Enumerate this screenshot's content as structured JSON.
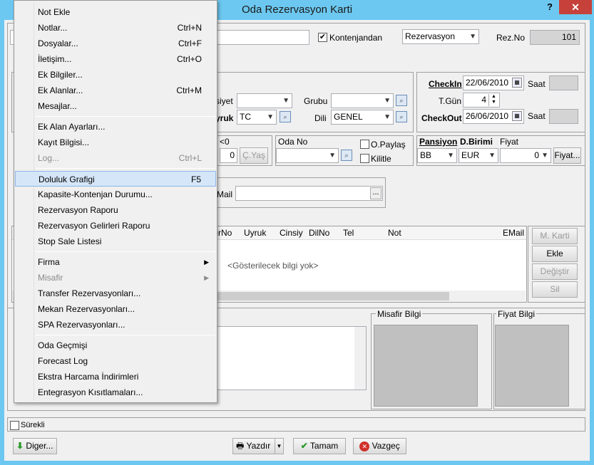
{
  "window": {
    "title": "Oda Rezervasyon Karti",
    "help": "?",
    "close": "✕"
  },
  "header": {
    "kontenjan_label": "Kontenjandan",
    "kontenjan_checked": true,
    "status_value": "Rezervasyon",
    "rezno_label": "Rez.No",
    "rezno_value": "101"
  },
  "guest": {
    "cinsiyet_label": "siyet",
    "grubu_label": "Grubu",
    "uyruk_label": "yruk",
    "uyruk_value": "TC",
    "dili_label": "Dili",
    "dili_value": "GENEL"
  },
  "dates": {
    "checkin_label": "CheckIn",
    "checkin_value": "22/06/2010",
    "saat_label": "Saat",
    "tgun_label": "T.Gün",
    "tgun_value": "4",
    "checkout_label": "CheckOut",
    "checkout_value": "26/06/2010"
  },
  "room": {
    "lt0_label": "<0",
    "lt0_value": "0",
    "cyas_button": "Ç.Yaş",
    "oda_no_label": "Oda No",
    "opaylas_label": "O.Paylaş",
    "kilitle_label": "Kilitle",
    "pansiyon_label": "Pansiyon",
    "dbirimi_label": "D.Birimi",
    "fiyat_label": "Fiyat",
    "pansiyon_value": "BB",
    "dbirimi_value": "EUR",
    "fiyat_value": "0",
    "fiyat_button": "Fiyat..."
  },
  "mail": {
    "label": "Mail",
    "button": "..."
  },
  "grid": {
    "columns": [
      "firNo",
      "Uyruk",
      "Cinsiy",
      "DilNo",
      "Tel",
      "Not",
      "EMail"
    ],
    "empty_text": "<Gösterilecek bilgi yok>",
    "side_buttons": [
      "M. Karti",
      "Ekle",
      "Değiştir",
      "Sil"
    ]
  },
  "bottom": {
    "misafir_bilgi": "Misafir Bilgi",
    "fiyat_bilgi": "Fiyat Bilgi",
    "surekli_label": "Sürekli",
    "diger_button": "Diger...",
    "yazdir_button": "Yazdır",
    "tamam_button": "Tamam",
    "vazgec_button": "Vazgeç"
  },
  "menu": {
    "items": [
      {
        "label": "Not Ekle",
        "shortcut": ""
      },
      {
        "label": "Notlar...",
        "shortcut": "Ctrl+N"
      },
      {
        "label": "Dosyalar...",
        "shortcut": "Ctrl+F"
      },
      {
        "label": "İletişim...",
        "shortcut": "Ctrl+O"
      },
      {
        "label": "Ek Bilgiler...",
        "shortcut": ""
      },
      {
        "label": "Ek Alanlar...",
        "shortcut": "Ctrl+M"
      },
      {
        "label": "Mesajlar...",
        "shortcut": ""
      },
      {
        "label": "Ek Alan Ayarları...",
        "shortcut": ""
      },
      {
        "label": "Kayıt Bilgisi...",
        "shortcut": ""
      },
      {
        "label": "Log...",
        "shortcut": "Ctrl+L"
      },
      {
        "label": "Doluluk Grafigi",
        "shortcut": "F5"
      },
      {
        "label": "Kapasite-Kontenjan Durumu...",
        "shortcut": ""
      },
      {
        "label": "Rezervasyon Raporu",
        "shortcut": ""
      },
      {
        "label": "Rezervasyon Gelirleri Raporu",
        "shortcut": ""
      },
      {
        "label": "Stop Sale Listesi",
        "shortcut": ""
      },
      {
        "label": "Firma",
        "shortcut": ""
      },
      {
        "label": "Misafir",
        "shortcut": ""
      },
      {
        "label": "Transfer Rezervasyonları...",
        "shortcut": ""
      },
      {
        "label": "Mekan Rezervasyonları...",
        "shortcut": ""
      },
      {
        "label": "SPA Rezervasyonları...",
        "shortcut": ""
      },
      {
        "label": "Oda Geçmişi",
        "shortcut": ""
      },
      {
        "label": "Forecast Log",
        "shortcut": ""
      },
      {
        "label": "Ekstra Harcama İndirimleri",
        "shortcut": ""
      },
      {
        "label": "Entegrasyon Kısıtlamaları...",
        "shortcut": ""
      }
    ]
  }
}
